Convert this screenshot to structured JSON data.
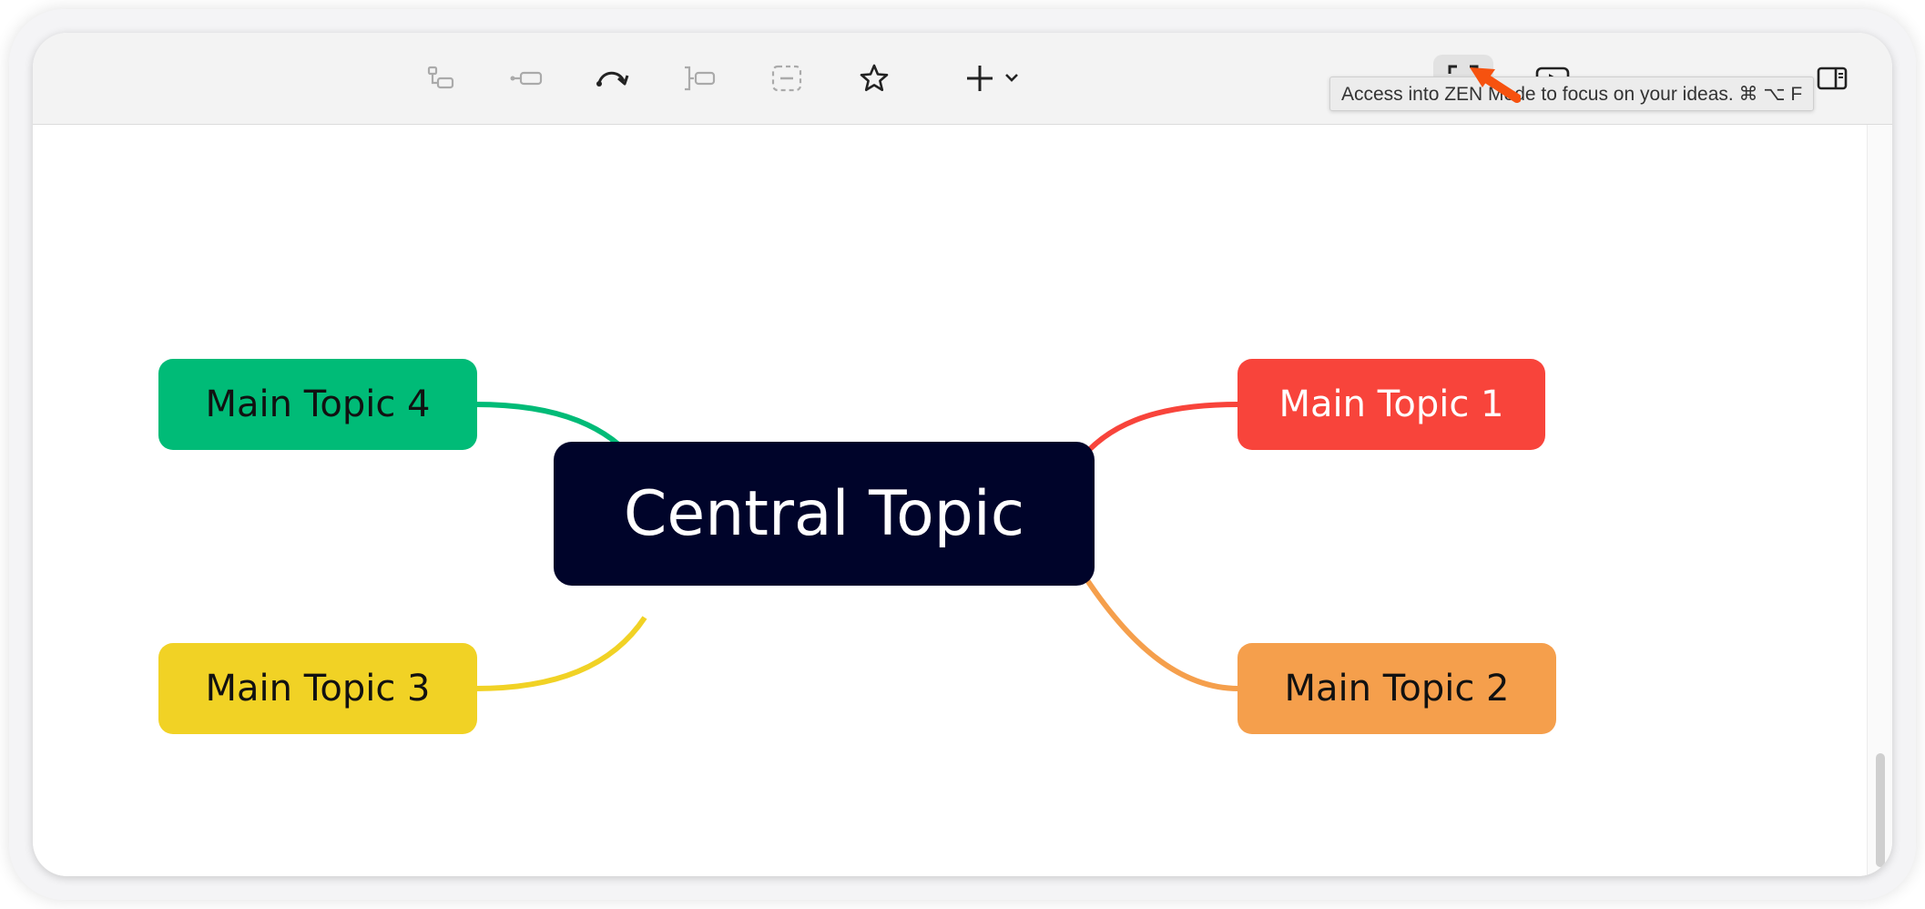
{
  "toolbar": {
    "buttons": [
      {
        "name": "subtopic-icon"
      },
      {
        "name": "topic-icon"
      },
      {
        "name": "relationship-icon"
      },
      {
        "name": "boundary-icon"
      },
      {
        "name": "summary-icon"
      },
      {
        "name": "star-icon"
      },
      {
        "name": "plus-icon"
      },
      {
        "name": "zen-mode-icon"
      },
      {
        "name": "pitch-play-icon"
      },
      {
        "name": "sidebar-panel-icon"
      }
    ]
  },
  "tooltip": {
    "text": "Access into ZEN Mode to focus on your ideas. ⌘ ⌥ F"
  },
  "mindmap": {
    "central": {
      "label": "Central Topic",
      "color": "#00042a"
    },
    "topics": [
      {
        "label": "Main Topic 1",
        "color": "#f8443b",
        "text_color": "#ffffff"
      },
      {
        "label": "Main Topic 2",
        "color": "#f59f4c",
        "text_color": "#111111"
      },
      {
        "label": "Main Topic 3",
        "color": "#f1d225",
        "text_color": "#111111"
      },
      {
        "label": "Main Topic 4",
        "color": "#00bb77",
        "text_color": "#111111"
      }
    ]
  },
  "annotation": {
    "arrow_color": "#f6520f"
  }
}
